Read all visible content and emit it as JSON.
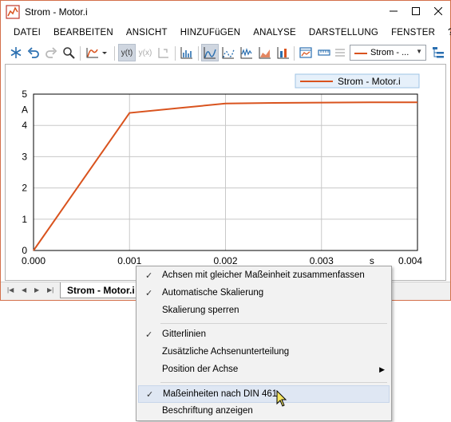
{
  "window": {
    "title": "Strom - Motor.i",
    "accent": "#d4704a"
  },
  "menu": [
    "DATEI",
    "BEARBEITEN",
    "ANSICHT",
    "HINZUFüGEN",
    "ANALYSE",
    "DARSTELLUNG",
    "FENSTER",
    "?"
  ],
  "toolbar": {
    "y_of_t": "y(t)",
    "y_of_x": "y(x)",
    "series_combo": "Strom - ..."
  },
  "chart": {
    "legend_label": "Strom - Motor.i",
    "y_unit": "A",
    "x_unit": "s",
    "line_color": "#d9531e"
  },
  "chart_data": {
    "type": "line",
    "title": "",
    "xlabel": "s",
    "ylabel": "A",
    "xlim": [
      0,
      0.004
    ],
    "ylim": [
      0,
      5
    ],
    "x_ticks": [
      "0.000",
      "0.001",
      "0.002",
      "0.003",
      "0.004"
    ],
    "y_ticks": [
      "0",
      "1",
      "2",
      "3",
      "4",
      "5"
    ],
    "grid": true,
    "legend": "top-right",
    "series": [
      {
        "name": "Strom - Motor.i",
        "color": "#d9531e",
        "x": [
          0,
          0.001,
          0.0015,
          0.002,
          0.0025,
          0.003,
          0.0035,
          0.004
        ],
        "y": [
          0,
          4.4,
          4.55,
          4.7,
          4.72,
          4.73,
          4.74,
          4.74
        ]
      }
    ]
  },
  "tabs": {
    "active": "Strom - Motor.i"
  },
  "context_menu": {
    "items": [
      {
        "label": "Achsen mit gleicher Maßeinheit zusammenfassen",
        "checked": true
      },
      {
        "label": "Automatische Skalierung",
        "checked": true
      },
      {
        "label": "Skalierung sperren",
        "checked": false
      },
      {
        "label": "Gitterlinien",
        "checked": true
      },
      {
        "label": "Zusätzliche Achsenunterteilung",
        "checked": false
      },
      {
        "label": "Position der Achse",
        "checked": false,
        "submenu": true
      },
      {
        "label": "Maßeinheiten nach DIN 461",
        "checked": true,
        "highlighted": true
      },
      {
        "label": "Beschriftung anzeigen",
        "checked": false
      }
    ]
  }
}
